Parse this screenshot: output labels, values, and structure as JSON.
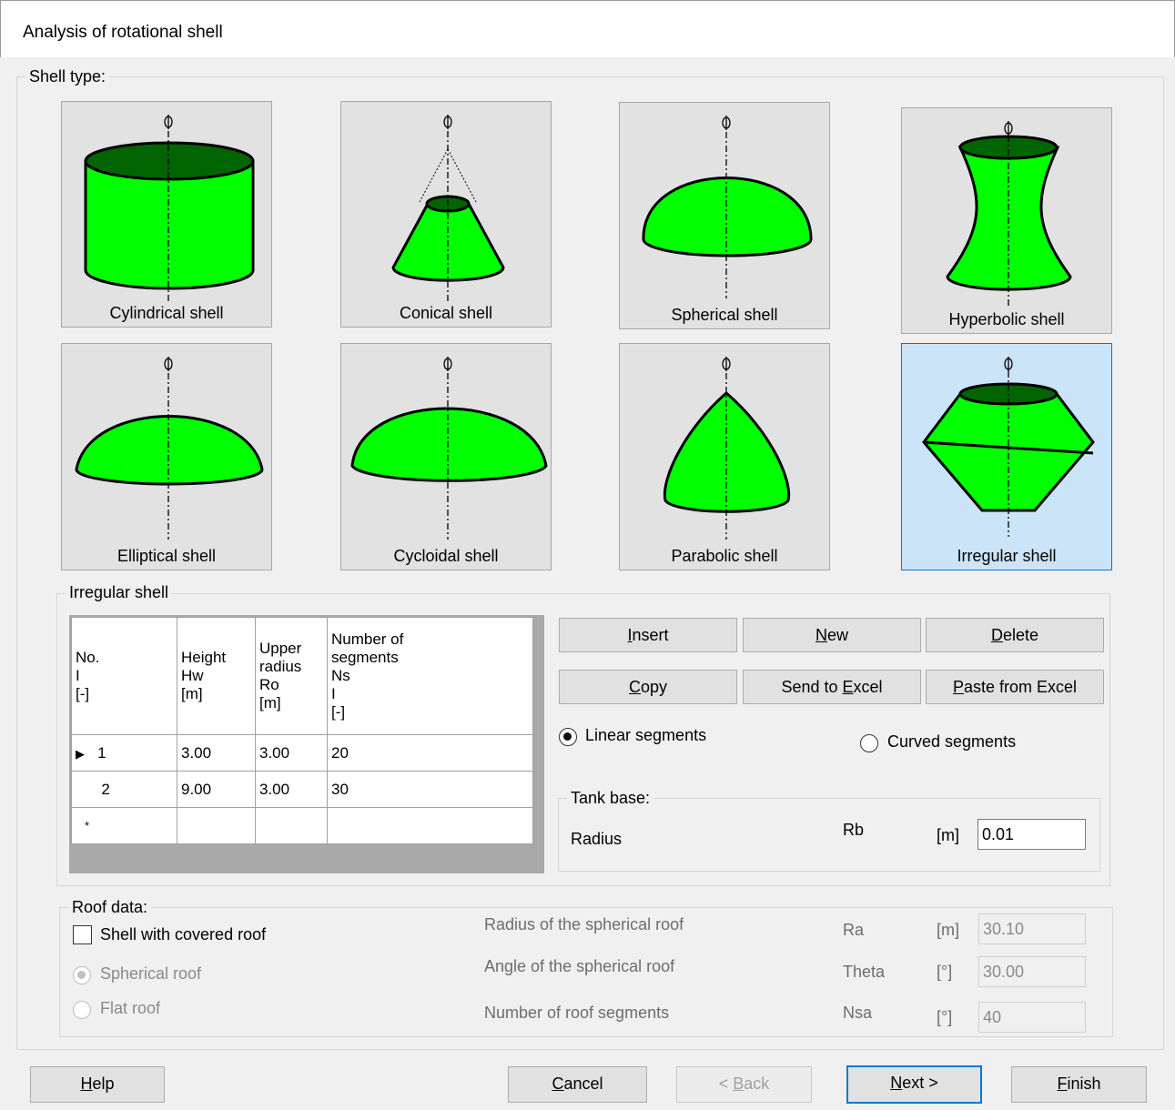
{
  "window": {
    "title": "Analysis of rotational shell"
  },
  "shell_type": {
    "legend": "Shell type:",
    "options": [
      {
        "label": "Cylindrical shell"
      },
      {
        "label": "Conical shell"
      },
      {
        "label": "Spherical shell"
      },
      {
        "label": "Hyperbolic shell"
      },
      {
        "label": "Elliptical shell"
      },
      {
        "label": "Cycloidal shell"
      },
      {
        "label": "Parabolic shell"
      },
      {
        "label": "Irregular shell"
      }
    ],
    "selected": "Irregular shell"
  },
  "irregular": {
    "legend": "Irregular shell",
    "table": {
      "columns": [
        {
          "lines": [
            "No.",
            "I",
            "[-]"
          ]
        },
        {
          "lines": [
            "Height",
            "Hw",
            "[m]"
          ]
        },
        {
          "lines": [
            "Upper",
            "radius",
            "Ro",
            "[m]"
          ]
        },
        {
          "lines": [
            "Number of",
            "segments",
            "Ns",
            "I",
            "[-]"
          ]
        }
      ],
      "rows": [
        {
          "no": "1",
          "height": "3.00",
          "radius": "3.00",
          "segments": "20"
        },
        {
          "no": "2",
          "height": "9.00",
          "radius": "3.00",
          "segments": "30"
        }
      ],
      "new_row_marker": "*"
    },
    "buttons": {
      "insert": {
        "u": "I",
        "rest": "nsert"
      },
      "new": {
        "u": "N",
        "rest": "ew"
      },
      "delete": {
        "u": "D",
        "rest": "elete"
      },
      "copy": {
        "u": "C",
        "rest": "opy"
      },
      "send_pre": "Send to ",
      "send_u": "E",
      "send_rest": "xcel",
      "paste": {
        "u": "P",
        "rest": "aste from Excel"
      }
    },
    "linear_label": "Linear segments",
    "curved_label": "Curved segments",
    "segment_mode": "Linear segments",
    "tank_base": {
      "legend": "Tank base:",
      "label": "Radius",
      "symbol": "Rb",
      "unit": "[m]",
      "value": "0.01"
    }
  },
  "roof": {
    "legend": "Roof data:",
    "covered_label": "Shell with covered roof",
    "covered_checked": false,
    "spherical_label": "Spherical roof",
    "flat_label": "Flat roof",
    "fields": [
      {
        "label": "Radius of the spherical roof",
        "symbol": "Ra",
        "unit": "[m]",
        "value": "30.10"
      },
      {
        "label": "Angle of the spherical roof",
        "symbol": "Theta",
        "unit": "[°]",
        "value": "30.00"
      },
      {
        "label": "Number of roof segments",
        "symbol": "Nsa",
        "unit": "[°]",
        "value": "40"
      }
    ]
  },
  "footer": {
    "help": {
      "u": "H",
      "rest": "elp"
    },
    "cancel": {
      "u": "C",
      "rest": "ancel"
    },
    "back_pre": "< ",
    "back_u": "B",
    "back_rest": "ack",
    "next_u": "N",
    "next_rest": "ext >",
    "finish": {
      "u": "F",
      "rest": "inish"
    }
  },
  "colors": {
    "shell_fill": "#00ff00",
    "shell_top": "#006400",
    "selected_tile": "#cce4f7",
    "accent": "#0078d7"
  }
}
